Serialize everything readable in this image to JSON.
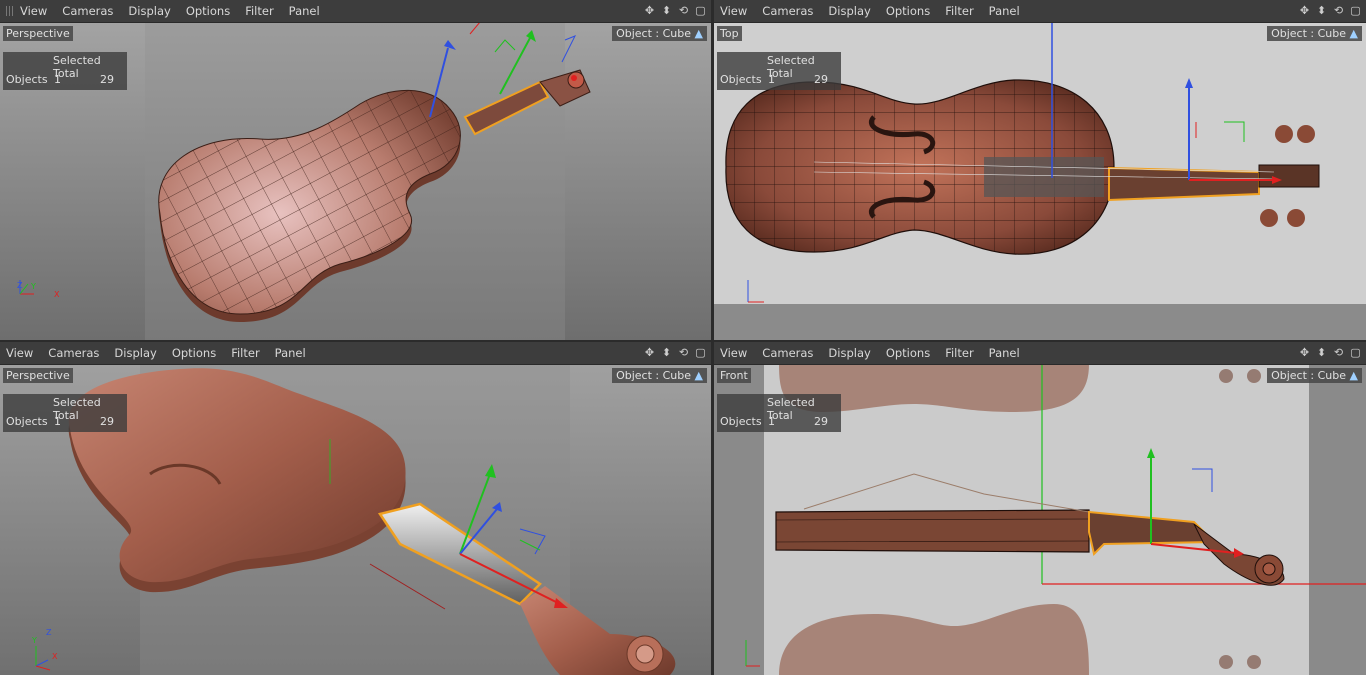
{
  "menu": [
    "View",
    "Cameras",
    "Display",
    "Options",
    "Filter",
    "Panel"
  ],
  "hud": {
    "header": "Selected Total",
    "row_label": "Objects",
    "selected": "1",
    "total": "29"
  },
  "object_label": "Object : Cube",
  "axis": {
    "x": "X",
    "y": "Y",
    "z": "Z"
  },
  "viewports": {
    "top_left": {
      "label": "Perspective"
    },
    "top_right": {
      "label": "Top"
    },
    "bottom_left": {
      "label": "Perspective"
    },
    "bottom_right": {
      "label": "Front"
    }
  },
  "colors": {
    "background": "#8c8c8c",
    "violin": "#9a5d4a",
    "selection": "#f0a020",
    "axis_x": "#e02020",
    "axis_y": "#20c020",
    "axis_z": "#3050e0"
  }
}
